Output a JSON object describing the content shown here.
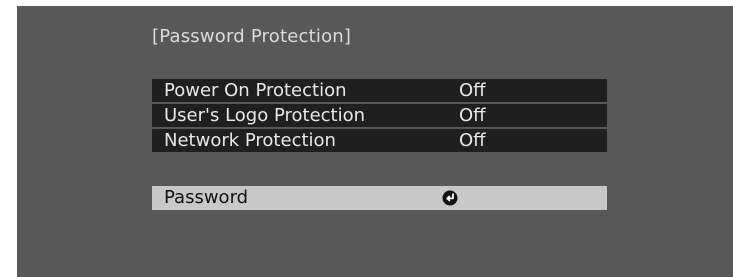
{
  "menu": {
    "title": "[Password Protection]",
    "items": [
      {
        "label": "Power On Protection",
        "value": "Off"
      },
      {
        "label": "User's Logo Protection",
        "value": "Off"
      },
      {
        "label": "Network Protection",
        "value": "Off"
      }
    ],
    "password": {
      "label": "Password",
      "icon": "enter-icon"
    }
  },
  "colors": {
    "screen_background": "#585858",
    "row_background": "#1f1f1f",
    "selected_background": "#c8c8c8"
  }
}
